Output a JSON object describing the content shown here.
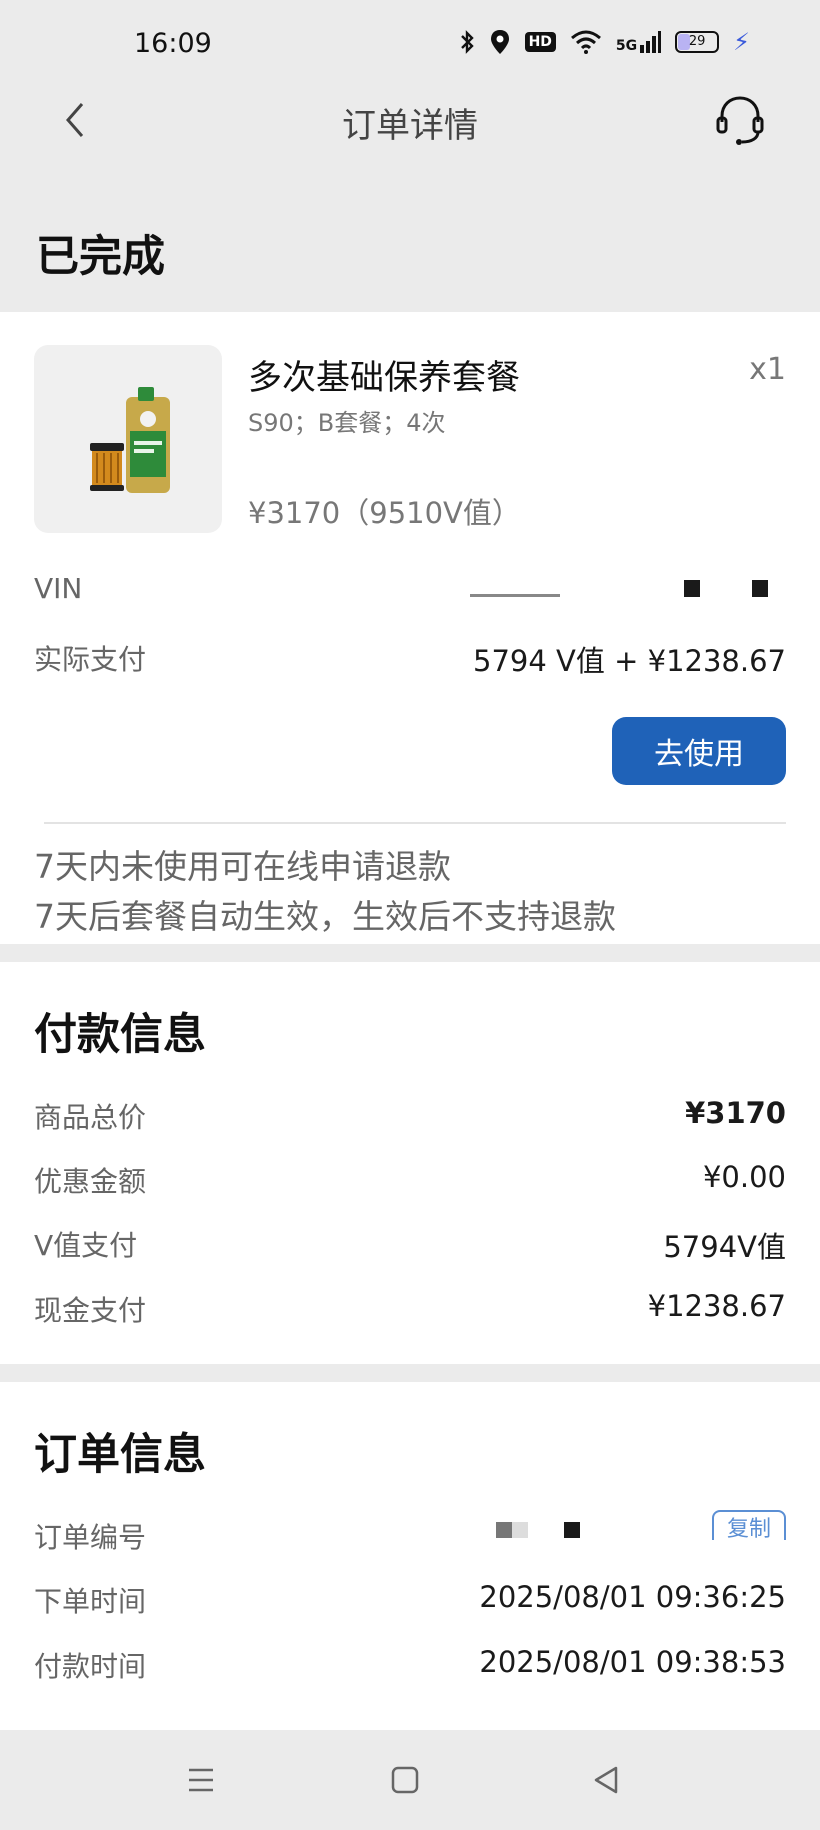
{
  "status_bar": {
    "time": "16:09",
    "net_label": "5G",
    "hd_label": "HD",
    "battery": "29",
    "icons": [
      "bluetooth-icon",
      "location-icon",
      "hd-icon",
      "wifi-icon",
      "5g-signal-icon",
      "battery-icon",
      "charging-icon"
    ]
  },
  "nav": {
    "title": "订单详情",
    "back_icon": "chevron-left-icon",
    "service_icon": "headset-icon"
  },
  "order_status": "已完成",
  "product": {
    "name": "多次基础保养套餐",
    "qty": "x1",
    "spec": "S90；B套餐；4次",
    "price": "¥3170（9510V值）"
  },
  "vin": {
    "label": "VIN"
  },
  "actual_pay": {
    "label": "实际支付",
    "value": "5794 V值 + ¥1238.67"
  },
  "use_button": "去使用",
  "notices": [
    "7天内未使用可在线申请退款",
    "7天后套餐自动生效，生效后不支持退款"
  ],
  "payment_info": {
    "title": "付款信息",
    "rows": [
      {
        "label": "商品总价",
        "value": "¥3170"
      },
      {
        "label": "优惠金额",
        "value": "¥0.00"
      },
      {
        "label": "V值支付",
        "value": "5794V值"
      },
      {
        "label": "现金支付",
        "value": "¥1238.67"
      }
    ]
  },
  "order_info": {
    "title": "订单信息",
    "rows": [
      {
        "label": "订单编号",
        "value": ""
      },
      {
        "label": "下单时间",
        "value": "2025/08/01 09:36:25"
      },
      {
        "label": "付款时间",
        "value": "2025/08/01 09:38:53"
      }
    ],
    "copy_label": "复制"
  },
  "system_nav": {
    "icons": [
      "menu-icon",
      "home-icon",
      "back-triangle-icon"
    ]
  },
  "colors": {
    "primary": "#1f62b8",
    "background": "#ebebeb",
    "card": "#ffffff",
    "muted": "#666666"
  }
}
